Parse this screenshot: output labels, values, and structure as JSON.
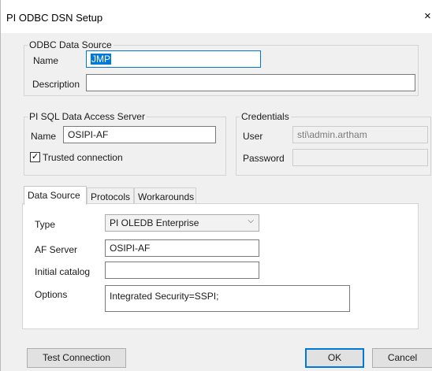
{
  "window": {
    "title": "PI ODBC DSN Setup",
    "close_glyph": "×"
  },
  "odbc_source": {
    "legend": "ODBC Data Source",
    "name_label": "Name",
    "name_value": "JMP",
    "description_label": "Description",
    "description_value": ""
  },
  "pi_sql_server": {
    "legend": "PI SQL Data Access Server",
    "name_label": "Name",
    "name_value": "OSIPI-AF",
    "trusted_label": "Trusted connection",
    "trusted_checked": true,
    "check_glyph": "✓"
  },
  "credentials": {
    "legend": "Credentials",
    "user_label": "User",
    "user_value": "sti\\admin.artham",
    "password_label": "Password",
    "password_value": ""
  },
  "tabs": [
    {
      "label": "Data Source",
      "active": true
    },
    {
      "label": "Protocols",
      "active": false
    },
    {
      "label": "Workarounds",
      "active": false
    }
  ],
  "data_source_tab": {
    "type_label": "Type",
    "type_value": "PI OLEDB Enterprise",
    "af_server_label": "AF Server",
    "af_server_value": "OSIPI-AF",
    "initial_catalog_label": "Initial catalog",
    "initial_catalog_value": "",
    "options_label": "Options",
    "options_value": "Integrated Security=SSPI;"
  },
  "buttons": {
    "test_connection": "Test Connection",
    "ok": "OK",
    "cancel": "Cancel"
  },
  "colors": {
    "accent": "#0078d7",
    "dialog_bg": "#f0f0f0"
  }
}
